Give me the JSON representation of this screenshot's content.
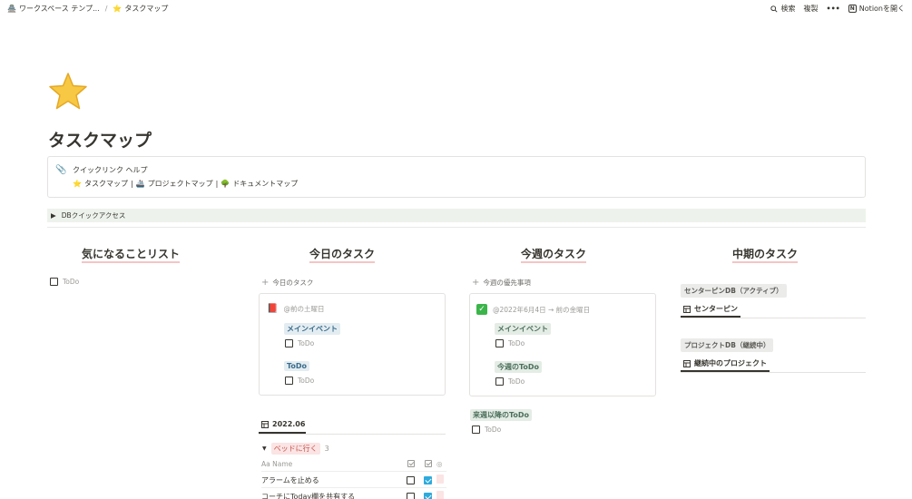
{
  "topbar": {
    "crumb1": "ワークスペース テンプ...",
    "crumb2": "タスクマップ",
    "search": "検索",
    "duplicate": "複製",
    "more": "•••",
    "open_in_notion": "Notionを開く"
  },
  "page": {
    "title": "タスクマップ",
    "icon": "star-icon"
  },
  "callout": {
    "line1": "クイックリンク ヘルプ",
    "link1": "タスクマップ",
    "sep1": "|",
    "link2": "プロジェクトマップ",
    "sep2": "|",
    "link3": "ドキュメントマップ"
  },
  "toggle": {
    "label": "DBクイックアクセス"
  },
  "columns": {
    "c1": {
      "title": "気になることリスト",
      "todo": "ToDo"
    },
    "c2": {
      "title": "今日のタスク",
      "add_label": "今日のタスク",
      "mention": "@前の土曜日",
      "heading1": "メインイベント",
      "todo1": "ToDo",
      "heading2": "ToDo",
      "todo2": "ToDo",
      "db_title": "2022.06",
      "group_label": "ベッドに行く",
      "group_count": "3",
      "col_name": "Name",
      "rows": [
        "アラームを止める",
        "コーチにToday欄を共有する"
      ]
    },
    "c3": {
      "title": "今週のタスク",
      "add_label": "今週の優先事項",
      "mention": "@2022年6月4日 → 前の金曜日",
      "heading1": "メインイベント",
      "todo1": "ToDo",
      "heading2": "今週のToDo",
      "todo2": "ToDo",
      "heading3": "来週以降のToDo",
      "todo3": "ToDo"
    },
    "c4": {
      "title": "中期のタスク",
      "label1": "センターピンDB（アクティブ）",
      "db1": "センターピン",
      "label2": "プロジェクトDB（継続中）",
      "db2": "継続中のプロジェクト"
    }
  }
}
